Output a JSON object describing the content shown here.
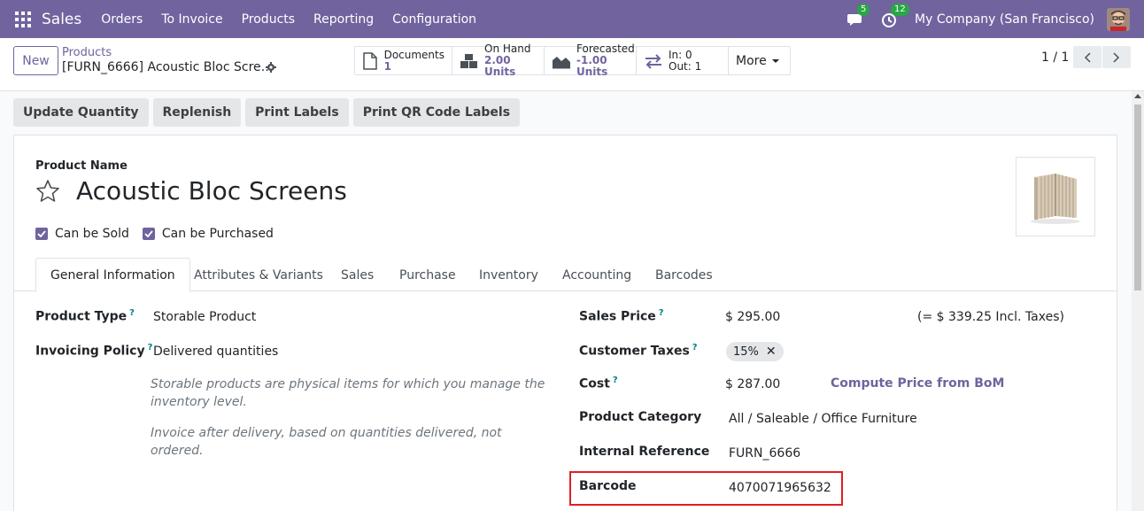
{
  "navbar": {
    "app_name": "Sales",
    "menu": [
      "Orders",
      "To Invoice",
      "Products",
      "Reporting",
      "Configuration"
    ],
    "messages_count": "5",
    "activities_count": "12",
    "company": "My Company (San Francisco)",
    "color": "#71639e"
  },
  "control_panel": {
    "new_label": "New",
    "breadcrumb_parent": "Products",
    "breadcrumb_current": "[FURN_6666] Acoustic Bloc Scre…",
    "smart_buttons": {
      "documents": {
        "label": "Documents",
        "value": "1"
      },
      "on_hand": {
        "label": "On Hand",
        "value": "2.00 Units"
      },
      "forecasted": {
        "label": "Forecasted",
        "value": "-1.00 Units"
      },
      "in_out": {
        "in": "In: 0",
        "out": "Out: 1"
      },
      "more": "More"
    },
    "pager": "1 / 1"
  },
  "actions": [
    "Update Quantity",
    "Replenish",
    "Print Labels",
    "Print QR Code Labels"
  ],
  "form": {
    "product_name_label": "Product Name",
    "product_name": "Acoustic Bloc Screens",
    "can_be_sold": "Can be Sold",
    "can_be_purchased": "Can be Purchased",
    "tabs": [
      "General Information",
      "Attributes & Variants",
      "Sales",
      "Purchase",
      "Inventory",
      "Accounting",
      "Barcodes"
    ],
    "active_tab": "General Information",
    "product_type_label": "Product Type",
    "product_type": "Storable Product",
    "invoicing_policy_label": "Invoicing Policy",
    "invoicing_policy": "Delivered quantities",
    "help_storable": "Storable products are physical items for which you manage the inventory level.",
    "help_invoice": "Invoice after delivery, based on quantities delivered, not ordered.",
    "sales_price_label": "Sales Price",
    "sales_price": "$ 295.00",
    "incl_taxes": "(= $ 339.25 Incl. Taxes)",
    "customer_taxes_label": "Customer Taxes",
    "customer_tax_tag": "15%",
    "cost_label": "Cost",
    "cost": "$ 287.00",
    "compute_price": "Compute Price from BoM",
    "category_label": "Product Category",
    "category": "All / Saleable / Office Furniture",
    "internal_ref_label": "Internal Reference",
    "internal_ref": "FURN_6666",
    "barcode_label": "Barcode",
    "barcode": "4070071965632",
    "help_mark": "?"
  }
}
